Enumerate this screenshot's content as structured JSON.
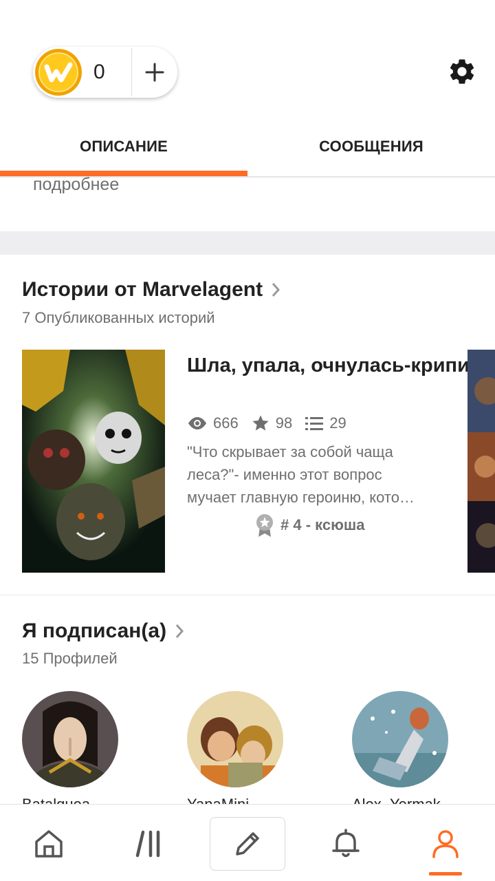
{
  "header": {
    "coin_count": "0",
    "coin_icon": "wattpad-coin-icon",
    "add_icon": "plus-icon",
    "settings_icon": "gear-icon"
  },
  "tabs": [
    {
      "label": "ОПИСАНИЕ",
      "active": true
    },
    {
      "label": "СООБЩЕНИЯ",
      "active": false
    }
  ],
  "about": {
    "more_link": "подробнее"
  },
  "stories": {
    "title": "Истории от Marvelagent",
    "subtitle": "7 Опубликованных историй",
    "items": [
      {
        "title": "Шла, упала, очнулась-крипи.",
        "reads": "666",
        "votes": "98",
        "parts": "29",
        "description": "\"Что скрывает за собой чаща леса?\"- именно этот вопрос мучает главную героиню, кото…",
        "description_lines": [
          "\"Что скрывает за собой чаща",
          "леса?\"- именно этот вопрос",
          "мучает главную героиню, кото…"
        ],
        "rank": "# 4 - ксюша"
      }
    ]
  },
  "following": {
    "title": "Я подписан(а)",
    "subtitle": "15 Профилей",
    "profiles": [
      {
        "name": "Batalquea"
      },
      {
        "name": "YanaMini"
      },
      {
        "name": "Alex_Yermak"
      }
    ]
  },
  "bottom_nav": [
    {
      "icon": "home-icon",
      "active": false
    },
    {
      "icon": "library-icon",
      "active": false
    },
    {
      "icon": "pencil-icon",
      "active": false
    },
    {
      "icon": "bell-icon",
      "active": false
    },
    {
      "icon": "profile-icon",
      "active": true
    }
  ],
  "colors": {
    "accent": "#ff6c24",
    "coin": "#f7b500",
    "text_primary": "#222222",
    "text_secondary": "#6f6f6f"
  }
}
